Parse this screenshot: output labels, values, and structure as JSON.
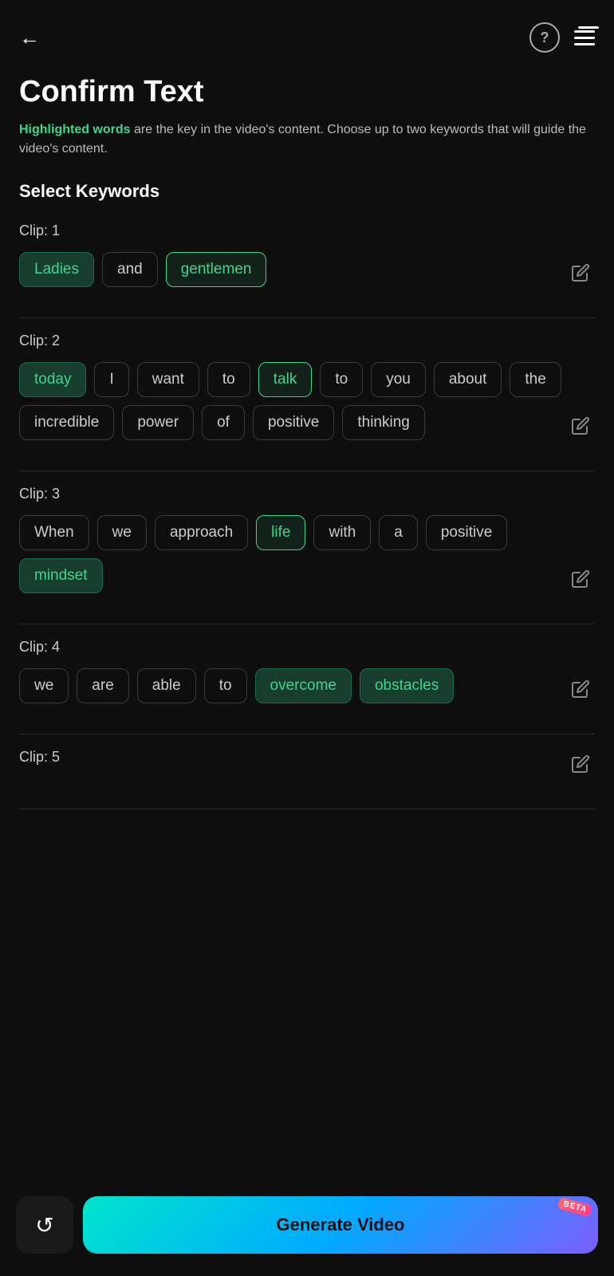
{
  "header": {
    "back_label": "←",
    "help_label": "?",
    "menu_has_notification": true
  },
  "title": "Confirm Text",
  "subtitle_highlight": "Highlighted words",
  "subtitle_rest": " are the key in the video's content. Choose up to two keywords that will guide the video's content.",
  "section_header": "Select Keywords",
  "clips": [
    {
      "label": "Clip: 1",
      "words": [
        {
          "text": "Ladies",
          "state": "selected-fill"
        },
        {
          "text": "and",
          "state": "normal"
        },
        {
          "text": "gentlemen",
          "state": "selected-green"
        }
      ]
    },
    {
      "label": "Clip: 2",
      "words": [
        {
          "text": "today",
          "state": "selected-fill"
        },
        {
          "text": "I",
          "state": "normal"
        },
        {
          "text": "want",
          "state": "normal"
        },
        {
          "text": "to",
          "state": "normal"
        },
        {
          "text": "talk",
          "state": "selected-green"
        },
        {
          "text": "to",
          "state": "normal"
        },
        {
          "text": "you",
          "state": "normal"
        },
        {
          "text": "about",
          "state": "normal"
        },
        {
          "text": "the",
          "state": "normal"
        },
        {
          "text": "incredible",
          "state": "normal"
        },
        {
          "text": "power",
          "state": "normal"
        },
        {
          "text": "of",
          "state": "normal"
        },
        {
          "text": "positive",
          "state": "normal"
        },
        {
          "text": "thinking",
          "state": "normal"
        }
      ]
    },
    {
      "label": "Clip: 3",
      "words": [
        {
          "text": "When",
          "state": "normal"
        },
        {
          "text": "we",
          "state": "normal"
        },
        {
          "text": "approach",
          "state": "normal"
        },
        {
          "text": "life",
          "state": "selected-green"
        },
        {
          "text": "with",
          "state": "normal"
        },
        {
          "text": "a",
          "state": "normal"
        },
        {
          "text": "positive",
          "state": "normal"
        },
        {
          "text": "mindset",
          "state": "selected-fill"
        }
      ]
    },
    {
      "label": "Clip: 4",
      "words": [
        {
          "text": "we",
          "state": "normal"
        },
        {
          "text": "are",
          "state": "normal"
        },
        {
          "text": "able",
          "state": "normal"
        },
        {
          "text": "to",
          "state": "normal"
        },
        {
          "text": "overcome",
          "state": "selected-fill"
        },
        {
          "text": "obstacles",
          "state": "selected-fill"
        }
      ]
    },
    {
      "label": "Clip: 5",
      "words": []
    }
  ],
  "bottom": {
    "reset_label": "↺",
    "generate_label": "Generate Video",
    "beta_label": "BETA"
  }
}
